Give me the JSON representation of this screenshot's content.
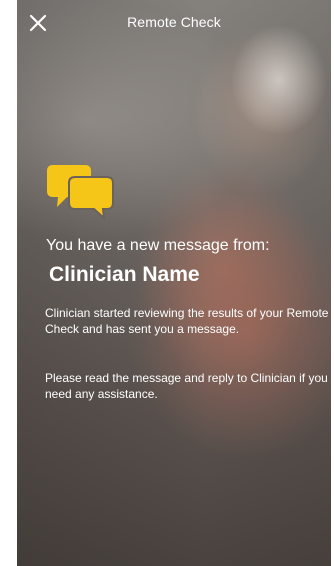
{
  "header": {
    "title": "Remote Check"
  },
  "icons": {
    "close": "close-icon",
    "chat": "chat-bubbles-icon"
  },
  "colors": {
    "accent": "#f5c518",
    "text": "#ffffff"
  },
  "message": {
    "intro": "You have a new message from:",
    "sender_name": "Clinician Name",
    "body": "Clinician started reviewing the results of your Remote Check and has sent you a message.",
    "instruction": "Please read the message and reply to Clinician if you need any assistance."
  }
}
